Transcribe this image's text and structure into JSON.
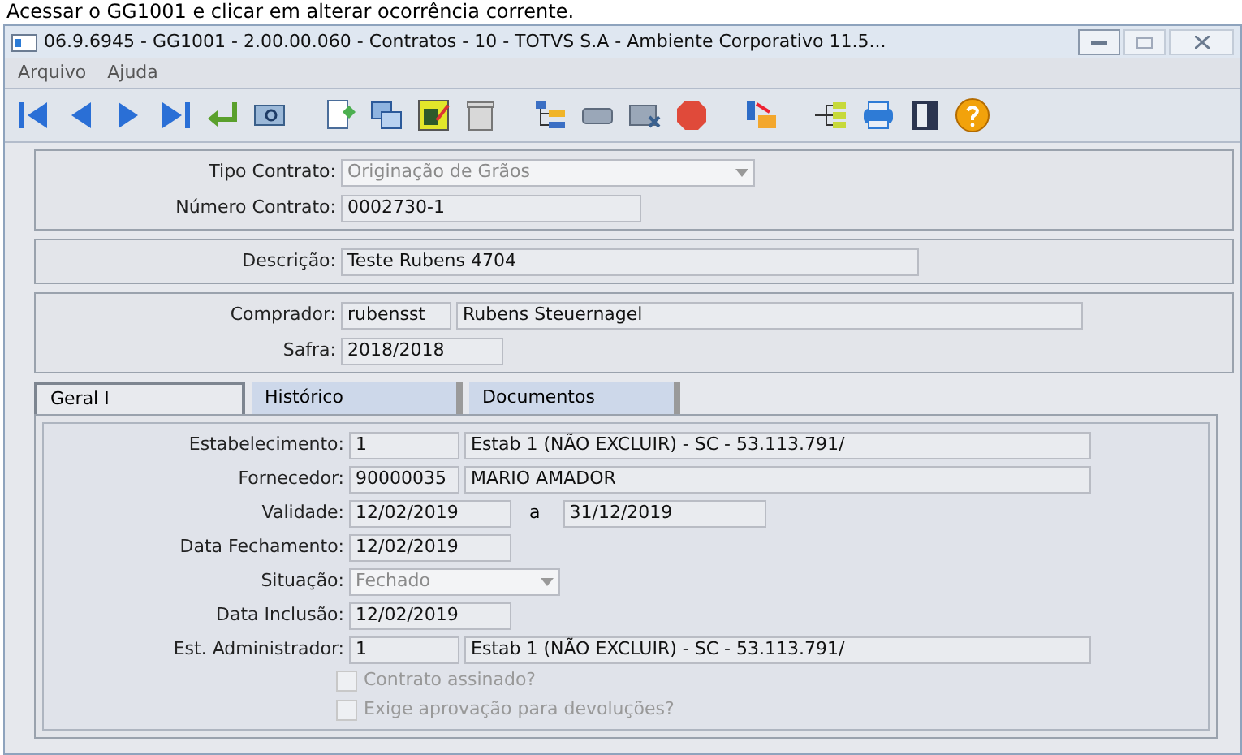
{
  "caption": "Acessar o GG1001 e clicar em alterar ocorrência corrente.",
  "window": {
    "title": "06.9.6945 - GG1001 - 2.00.00.060 - Contratos - 10 - TOTVS S.A - Ambiente Corporativo 11.5..."
  },
  "menu": [
    "Arquivo",
    "Ajuda"
  ],
  "sections": [
    {
      "fields": [
        {
          "label": "Tipo Contrato:",
          "kind": "dropdown",
          "values": [
            "Originação de Grãos"
          ],
          "disabled": true
        },
        {
          "label": "Número Contrato:",
          "kind": "text",
          "values": [
            "0002730-1"
          ],
          "disabled": false
        }
      ]
    },
    {
      "fields": [
        {
          "label": "Descrição:",
          "kind": "text",
          "values": [
            "Teste Rubens 4704"
          ],
          "disabled": false
        }
      ]
    },
    {
      "fields": [
        {
          "label": "Comprador:",
          "kind": "text",
          "values": [
            "rubensst",
            "Rubens Steuernagel"
          ],
          "disabled": false
        },
        {
          "label": "Safra:",
          "kind": "text",
          "values": [
            "2018/2018"
          ],
          "disabled": false
        }
      ]
    }
  ],
  "tabs": [
    {
      "label": "Geral I",
      "selected": true
    },
    {
      "label": "Histórico",
      "selected": false
    },
    {
      "label": "Documentos",
      "selected": false
    }
  ],
  "tab_fields": [
    {
      "label": "Estabelecimento:",
      "kind": "text",
      "values": [
        "1",
        "Estab 1 (NÃO EXCLUIR) - SC - 53.113.791/"
      ],
      "disabled": false
    },
    {
      "label": "Fornecedor:",
      "kind": "text",
      "values": [
        "90000035",
        "MARIO AMADOR"
      ],
      "disabled": false
    },
    {
      "label": "Validade:",
      "kind": "range",
      "values": [
        "12/02/2019",
        "31/12/2019"
      ],
      "separator": "a",
      "disabled": false
    },
    {
      "label": "Data Fechamento:",
      "kind": "text",
      "values": [
        "12/02/2019"
      ],
      "disabled": false
    },
    {
      "label": "Situação:",
      "kind": "dropdown",
      "values": [
        "Fechado"
      ],
      "disabled": true
    },
    {
      "label": "Data Inclusão:",
      "kind": "text",
      "values": [
        "12/02/2019"
      ],
      "disabled": false
    },
    {
      "label": "Est. Administrador:",
      "kind": "text",
      "values": [
        "1",
        "Estab 1 (NÃO EXCLUIR) - SC - 53.113.791/"
      ],
      "disabled": false
    }
  ],
  "checkboxes": [
    {
      "label": "Contrato assinado?",
      "checked": false,
      "disabled": true
    },
    {
      "label": "Exige aprovação para devoluções?",
      "checked": false,
      "disabled": true
    }
  ]
}
